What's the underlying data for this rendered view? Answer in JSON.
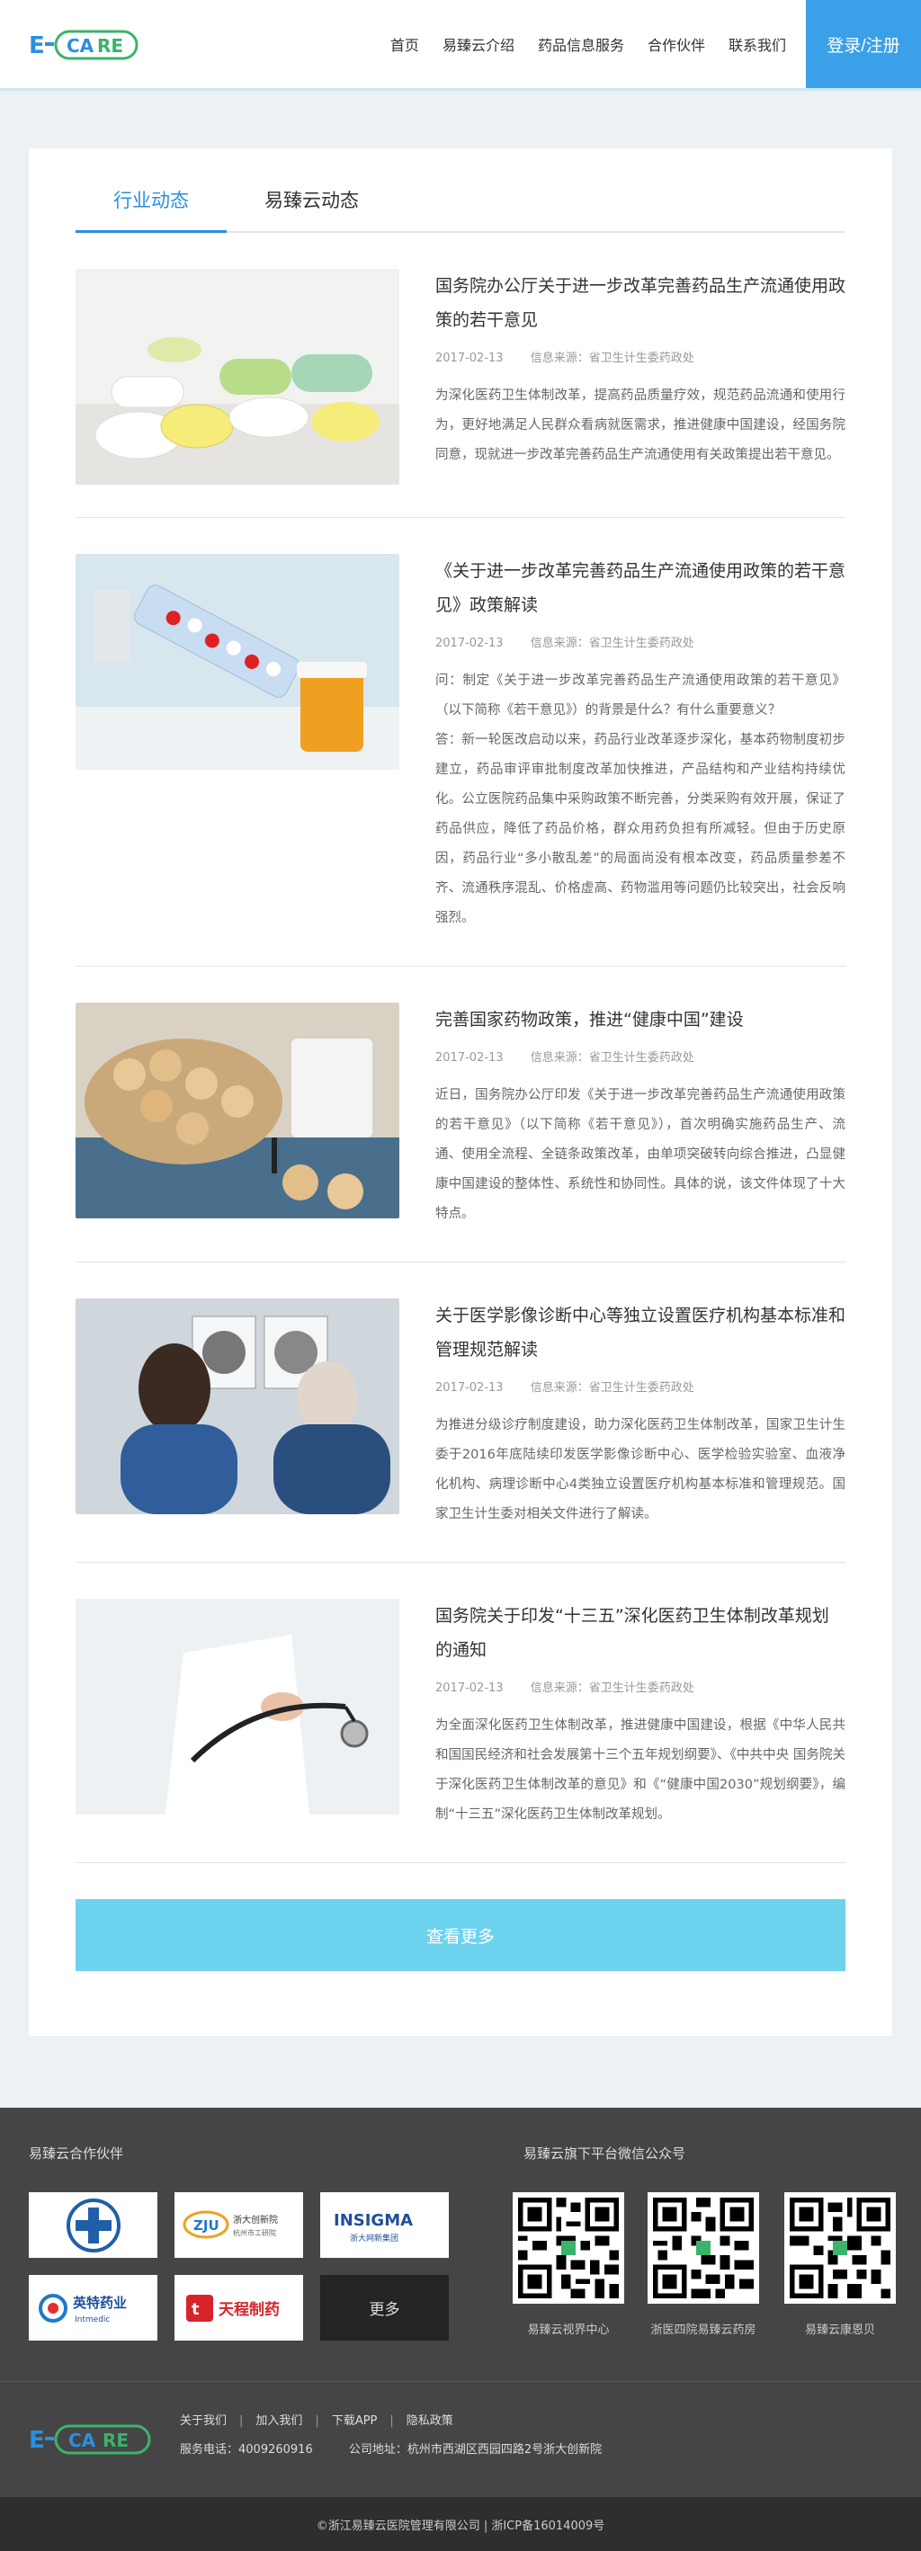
{
  "header": {
    "logo_text": "E-CARE",
    "nav": [
      "首页",
      "易臻云介绍",
      "药品信息服务",
      "合作伙伴",
      "联系我们"
    ],
    "login_label": "登录/注册"
  },
  "tabs": [
    "行业动态",
    "易臻云动态"
  ],
  "news": [
    {
      "title": "国务院办公厅关于进一步改革完善药品生产流通使用政策的若干意见",
      "date": "2017-02-13",
      "source": "信息来源：省卫生计生委药政处",
      "summary": "为深化医药卫生体制改革，提高药品质量疗效，规范药品流通和使用行为，更好地满足人民群众看病就医需求，推进健康中国建设，经国务院同意，现就进一步改革完善药品生产流通使用有关政策提出若干意见。"
    },
    {
      "title": "《关于进一步改革完善药品生产流通使用政策的若干意见》政策解读",
      "date": "2017-02-13",
      "source": "信息来源：省卫生计生委药政处",
      "summary": "问：制定《关于进一步改革完善药品生产流通使用政策的若干意见》（以下简称《若干意见》）的背景是什么？有什么重要意义？\n答：新一轮医改启动以来，药品行业改革逐步深化，基本药物制度初步建立，药品审评审批制度改革加快推进，产品结构和产业结构持续优化。公立医院药品集中采购政策不断完善，分类采购有效开展，保证了药品供应，降低了药品价格，群众用药负担有所减轻。但由于历史原因，药品行业“多小散乱差”的局面尚没有根本改变，药品质量参差不齐、流通秩序混乱、价格虚高、药物滥用等问题仍比较突出，社会反响强烈。"
    },
    {
      "title": "完善国家药物政策，推进“健康中国”建设",
      "date": "2017-02-13",
      "source": "信息来源：省卫生计生委药政处",
      "summary": "近日，国务院办公厅印发《关于进一步改革完善药品生产流通使用政策的若干意见》（以下简称《若干意见》），首次明确实施药品生产、流通、使用全流程、全链条政策改革，由单项突破转向综合推进，凸显健康中国建设的整体性、系统性和协同性。具体的说，该文件体现了十大特点。"
    },
    {
      "title": "关于医学影像诊断中心等独立设置医疗机构基本标准和管理规范解读",
      "date": "2017-02-13",
      "source": "信息来源：省卫生计生委药政处",
      "summary": "为推进分级诊疗制度建设，助力深化医药卫生体制改革，国家卫生计生委于2016年底陆续印发医学影像诊断中心、医学检验实验室、血液净化机构、病理诊断中心4类独立设置医疗机构基本标准和管理规范。国家卫生计生委对相关文件进行了解读。"
    },
    {
      "title": "国务院关于印发“十三五”深化医药卫生体制改革规划的通知",
      "date": "2017-02-13",
      "source": "信息来源：省卫生计生委药政处",
      "summary": "为全面深化医药卫生体制改革，推进健康中国建设，根据《中华人民共和国国民经济和社会发展第十三个五年规划纲要》、《中共中央 国务院关于深化医药卫生体制改革的意见》和《“健康中国2030”规划纲要》，编制“十三五”深化医药卫生体制改革规划。"
    }
  ],
  "more_label": "查看更多",
  "footer": {
    "partners_title": "易臻云合作伙伴",
    "partners": [
      {
        "name": "",
        "sub": ""
      },
      {
        "name": "浙大创新院",
        "sub": "杭州市工研院"
      },
      {
        "name": "INSIGMA",
        "sub": "浙大网新集团"
      },
      {
        "name": "英特药业",
        "sub": "Intmedic"
      },
      {
        "name": "天程制药",
        "sub": ""
      }
    ],
    "partners_more": "更多",
    "wechat_title": "易臻云旗下平台微信公众号",
    "qr_labels": [
      "易臻云视界中心",
      "浙医四院易臻云药房",
      "易臻云康恩贝"
    ],
    "links": [
      "关于我们",
      "加入我们",
      "下载APP",
      "隐私政策"
    ],
    "phone": "服务电话：4009260916",
    "address": "公司地址：杭州市西湖区西园四路2号浙大创新院",
    "copyright": "©浙江易臻云医院管理有限公司 | 浙ICP备16014009号"
  },
  "colors": {
    "accent": "#2b8fe0",
    "login_bg": "#3aa0e8",
    "more_btn": "#6dd2ee",
    "footer_bg": "#454545"
  }
}
